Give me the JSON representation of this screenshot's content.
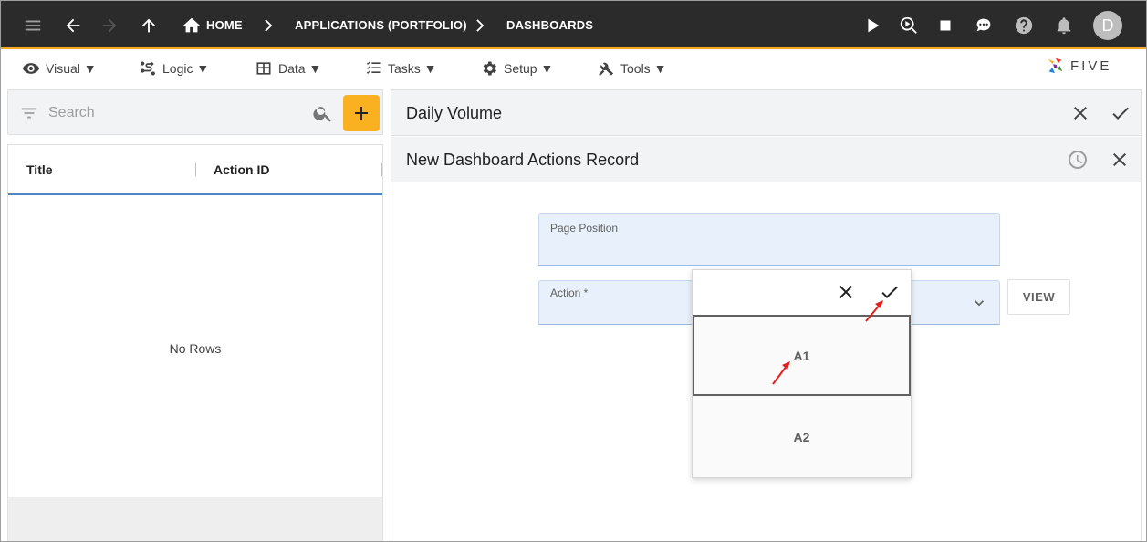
{
  "topbar": {
    "breadcrumbs": [
      "HOME",
      "APPLICATIONS (PORTFOLIO)",
      "DASHBOARDS"
    ],
    "avatar_letter": "D"
  },
  "menu": {
    "items": [
      "Visual ▼",
      "Logic ▼",
      "Data ▼",
      "Tasks ▼",
      "Setup ▼",
      "Tools ▼"
    ],
    "logo_text": "FIVE"
  },
  "search": {
    "placeholder": "Search"
  },
  "list": {
    "columns": [
      "Title",
      "Action ID"
    ],
    "empty_text": "No Rows"
  },
  "right": {
    "panel_title": "Daily Volume",
    "record_title": "New Dashboard Actions Record",
    "fields": {
      "page_position_label": "Page Position",
      "action_label": "Action *"
    },
    "view_button": "VIEW"
  },
  "dropdown": {
    "options": [
      "A1",
      "A2"
    ],
    "selected": "A1"
  },
  "colors": {
    "accent": "#f9b122",
    "topbar": "#2b2b2b",
    "field_bg": "#e8f1fb",
    "annotation_arrow": "#e02020"
  }
}
